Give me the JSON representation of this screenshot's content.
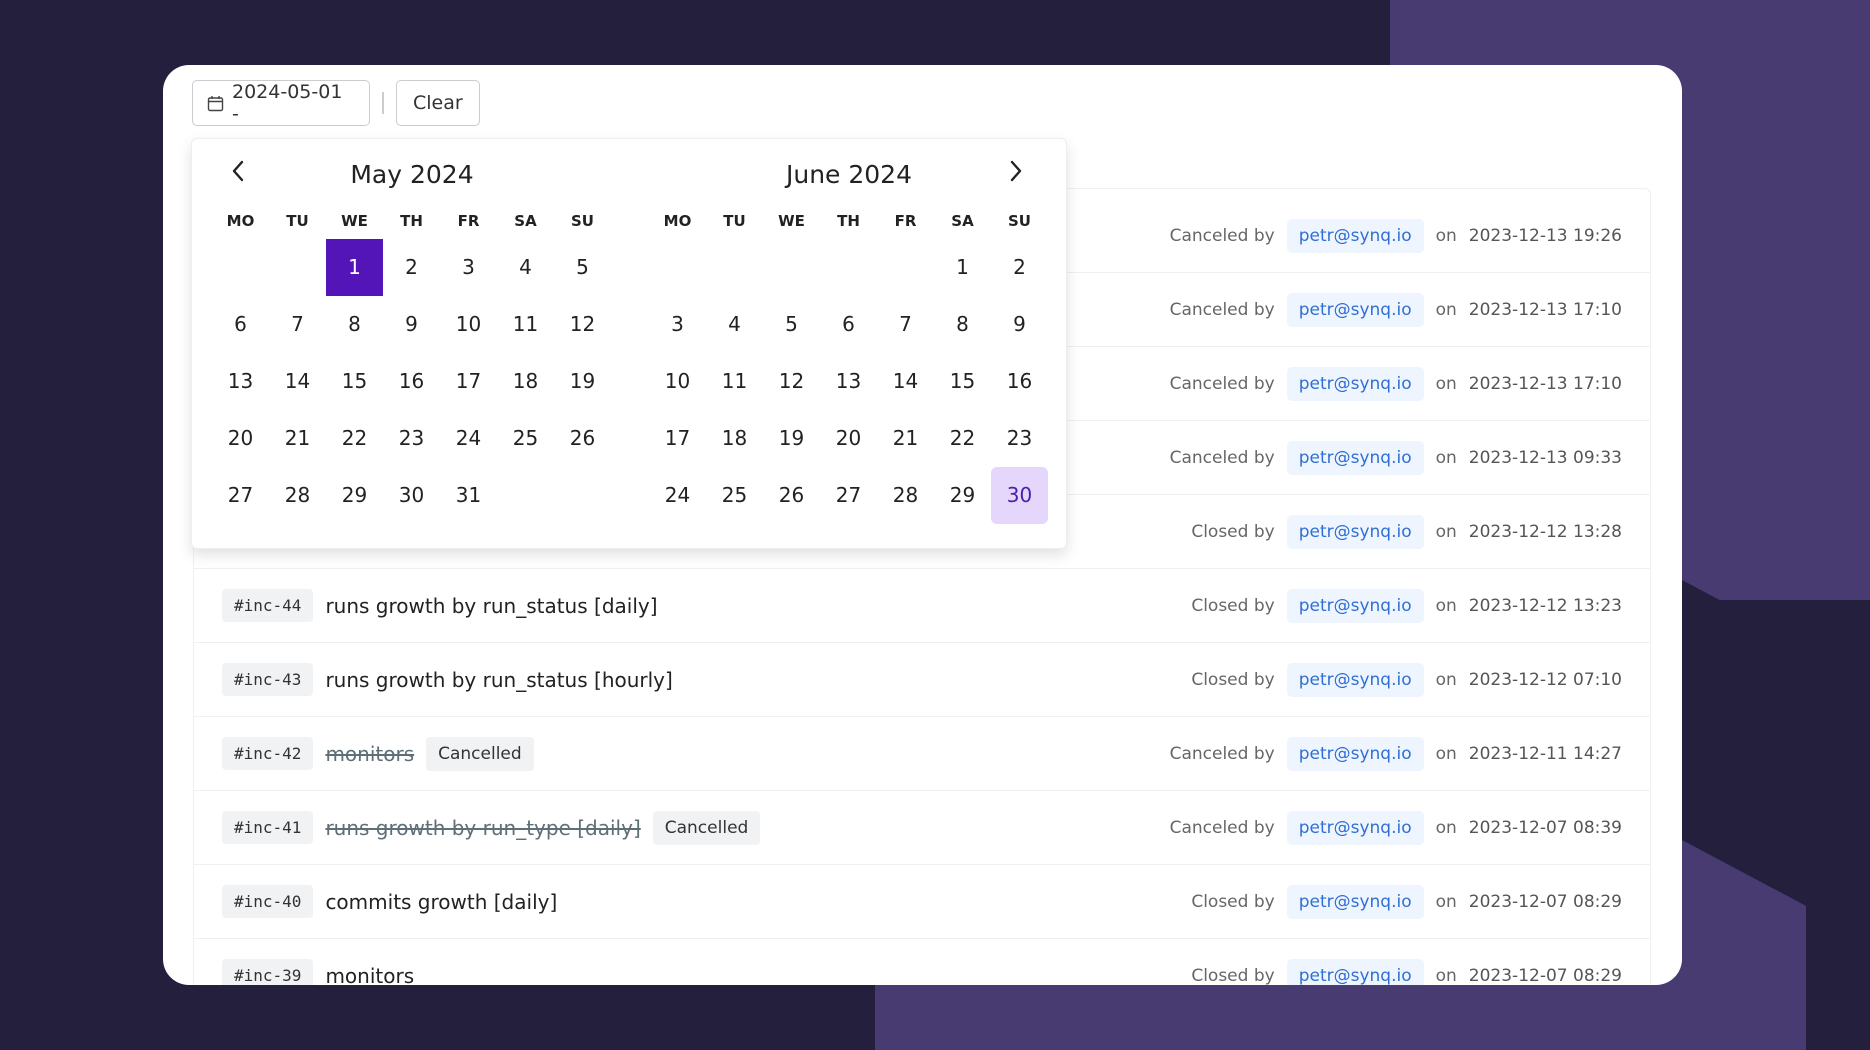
{
  "colors": {
    "background": "#251f3e",
    "background_accent": "#473b72",
    "range_start": "#5314b8",
    "range_end": "#e5d6fb",
    "user_link": "#2f6fd3"
  },
  "toolbar": {
    "date_icon": "calendar-icon",
    "date_value": "2024-05-01 -",
    "clear_label": "Clear"
  },
  "datepicker": {
    "prev_icon": "chevron-left-icon",
    "next_icon": "chevron-right-icon",
    "weekdays": [
      "MO",
      "TU",
      "WE",
      "TH",
      "FR",
      "SA",
      "SU"
    ],
    "months": [
      {
        "title": "May 2024",
        "leading_blanks": 2,
        "days": 31,
        "selected_start": 1,
        "selected_end": null
      },
      {
        "title": "June 2024",
        "leading_blanks": 5,
        "days": 30,
        "selected_start": null,
        "selected_end": 30
      }
    ]
  },
  "incidents": [
    {
      "id": "",
      "title": "",
      "status": "",
      "action": "Canceled by",
      "user": "petr@synq.io",
      "on": "on",
      "when": "2023-12-13 19:26"
    },
    {
      "id": "",
      "title": "",
      "status": "",
      "action": "Canceled by",
      "user": "petr@synq.io",
      "on": "on",
      "when": "2023-12-13 17:10"
    },
    {
      "id": "",
      "title": "",
      "status": "",
      "action": "Canceled by",
      "user": "petr@synq.io",
      "on": "on",
      "when": "2023-12-13 17:10"
    },
    {
      "id": "",
      "title": "",
      "status": "",
      "action": "Canceled by",
      "user": "petr@synq.io",
      "on": "on",
      "when": "2023-12-13 09:33"
    },
    {
      "id": "",
      "title": "",
      "status": "",
      "action": "Closed by",
      "user": "petr@synq.io",
      "on": "on",
      "when": "2023-12-12 13:28"
    },
    {
      "id": "#inc-44",
      "title": "runs growth by run_status [daily]",
      "status": "",
      "action": "Closed by",
      "user": "petr@synq.io",
      "on": "on",
      "when": "2023-12-12 13:23"
    },
    {
      "id": "#inc-43",
      "title": "runs growth by run_status [hourly]",
      "status": "",
      "action": "Closed by",
      "user": "petr@synq.io",
      "on": "on",
      "when": "2023-12-12 07:10"
    },
    {
      "id": "#inc-42",
      "title": "monitors",
      "status": "Cancelled",
      "action": "Canceled by",
      "user": "petr@synq.io",
      "on": "on",
      "when": "2023-12-11 14:27"
    },
    {
      "id": "#inc-41",
      "title": "runs growth by run_type [daily]",
      "status": "Cancelled",
      "action": "Canceled by",
      "user": "petr@synq.io",
      "on": "on",
      "when": "2023-12-07 08:39"
    },
    {
      "id": "#inc-40",
      "title": "commits growth [daily]",
      "status": "",
      "action": "Closed by",
      "user": "petr@synq.io",
      "on": "on",
      "when": "2023-12-07 08:29"
    },
    {
      "id": "#inc-39",
      "title": "monitors",
      "status": "",
      "action": "Closed by",
      "user": "petr@synq.io",
      "on": "on",
      "when": "2023-12-07 08:29"
    }
  ]
}
